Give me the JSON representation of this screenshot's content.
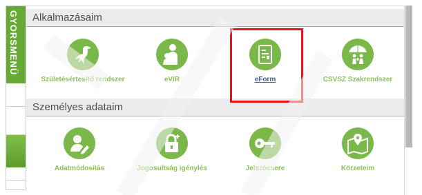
{
  "sidebar": {
    "title": "GYORSMENÜ"
  },
  "sections": {
    "apps": {
      "title": "Alkalmazásaim"
    },
    "personal": {
      "title": "Személyes adataim"
    }
  },
  "apps": [
    {
      "label": "Születésértesítő rendszer",
      "icon": "stork-icon"
    },
    {
      "label": "eVIR",
      "icon": "parent-child-icon"
    },
    {
      "label": "eForm",
      "icon": "form-document-icon"
    },
    {
      "label": "CSVSZ Szakrendszer",
      "icon": "family-umbrella-icon"
    }
  ],
  "personal": [
    {
      "label": "Adatmódosítás",
      "icon": "user-edit-icon"
    },
    {
      "label": "Jogosultság igénylés",
      "icon": "lock-plus-icon"
    },
    {
      "label": "Jelszócsere",
      "icon": "key-icon"
    },
    {
      "label": "Körzeteim",
      "icon": "map-pin-icon"
    }
  ],
  "colors": {
    "accent": "#7bb84a",
    "highlight": "#e8141a",
    "link": "#3d5fa8"
  }
}
